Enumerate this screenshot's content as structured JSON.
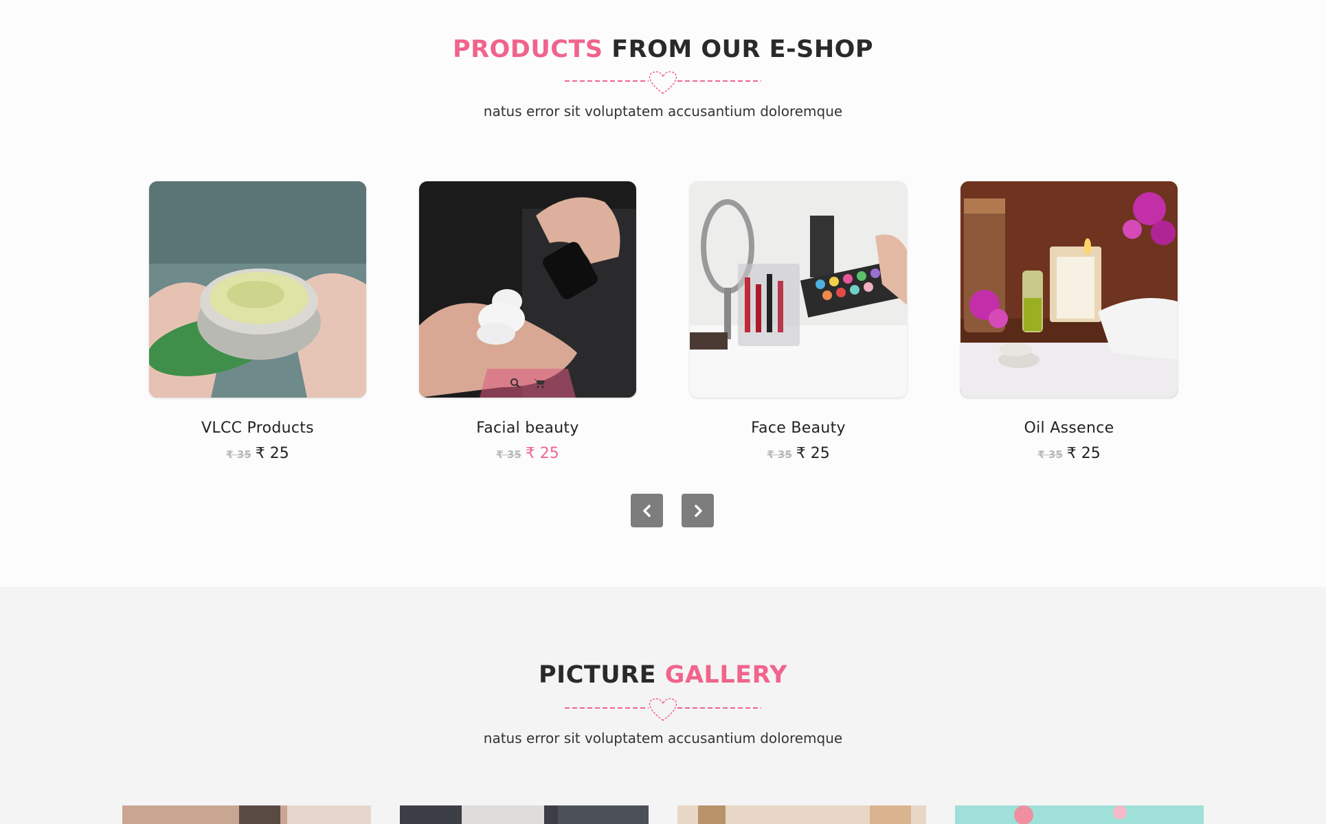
{
  "shop": {
    "title_pink": "PRODUCTS",
    "title_dark": "FROM OUR E-SHOP",
    "subtitle": "natus error sit voluptatem accusantium doloremque",
    "products": [
      {
        "name": "VLCC Products",
        "old_price": "₹ 35",
        "price": "₹ 25"
      },
      {
        "name": "Facial beauty",
        "old_price": "₹ 35",
        "price": "₹ 25"
      },
      {
        "name": "Face Beauty",
        "old_price": "₹ 35",
        "price": "₹ 25"
      },
      {
        "name": "Oil Assence",
        "old_price": "₹ 35",
        "price": "₹ 25"
      }
    ],
    "carousel_controls": {
      "prev_icon": "chevron-left-icon",
      "next_icon": "chevron-right-icon"
    },
    "hover_icons": [
      "search-icon",
      "cart-icon"
    ]
  },
  "gallery": {
    "title_dark": "PICTURE",
    "title_pink": "GALLERY",
    "subtitle": "natus error sit voluptatem accusantium doloremque"
  },
  "colors": {
    "accent": "#f0648c",
    "dark": "#2a2a2a",
    "button": "#7d7d7d",
    "gallery_bg": "#f4f4f4"
  }
}
